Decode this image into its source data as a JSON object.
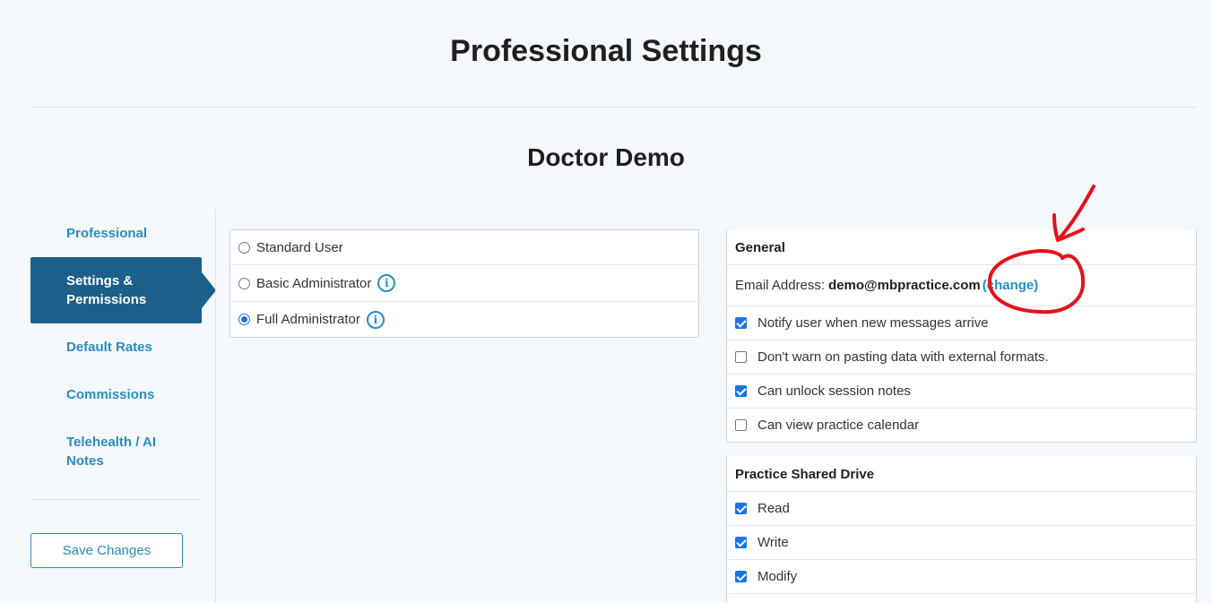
{
  "page": {
    "title": "Professional Settings",
    "user_name": "Doctor Demo"
  },
  "sidebar": {
    "items": [
      {
        "label": "Professional"
      },
      {
        "label": "Settings & Permissions"
      },
      {
        "label": "Default Rates"
      },
      {
        "label": "Commissions"
      },
      {
        "label": "Telehealth / AI Notes"
      }
    ],
    "active_item": "Settings & Permissions",
    "save_label": "Save Changes"
  },
  "roles": {
    "options": [
      {
        "label": "Standard User",
        "checked": false,
        "info": false
      },
      {
        "label": "Basic Administrator",
        "checked": false,
        "info": true
      },
      {
        "label": "Full Administrator",
        "checked": true,
        "info": true
      }
    ]
  },
  "general": {
    "title": "General",
    "email_label": "Email Address:",
    "email_value": "demo@mbpractice.com",
    "change_label": "(change)",
    "options": [
      {
        "label": "Notify user when new messages arrive",
        "checked": true
      },
      {
        "label": "Don't warn on pasting data with external formats.",
        "checked": false
      },
      {
        "label": "Can unlock session notes",
        "checked": true
      },
      {
        "label": "Can view practice calendar",
        "checked": false
      }
    ]
  },
  "shared_drive": {
    "title": "Practice Shared Drive",
    "options": [
      {
        "label": "Read",
        "checked": true
      },
      {
        "label": "Write",
        "checked": true
      },
      {
        "label": "Modify",
        "checked": true
      }
    ]
  },
  "colors": {
    "accent": "#2a8cc4",
    "active_nav": "#1b5f8a",
    "annotation": "#e8101a"
  },
  "icons": {
    "info": "info-icon",
    "annotation_arrow": "arrow-annotation"
  }
}
